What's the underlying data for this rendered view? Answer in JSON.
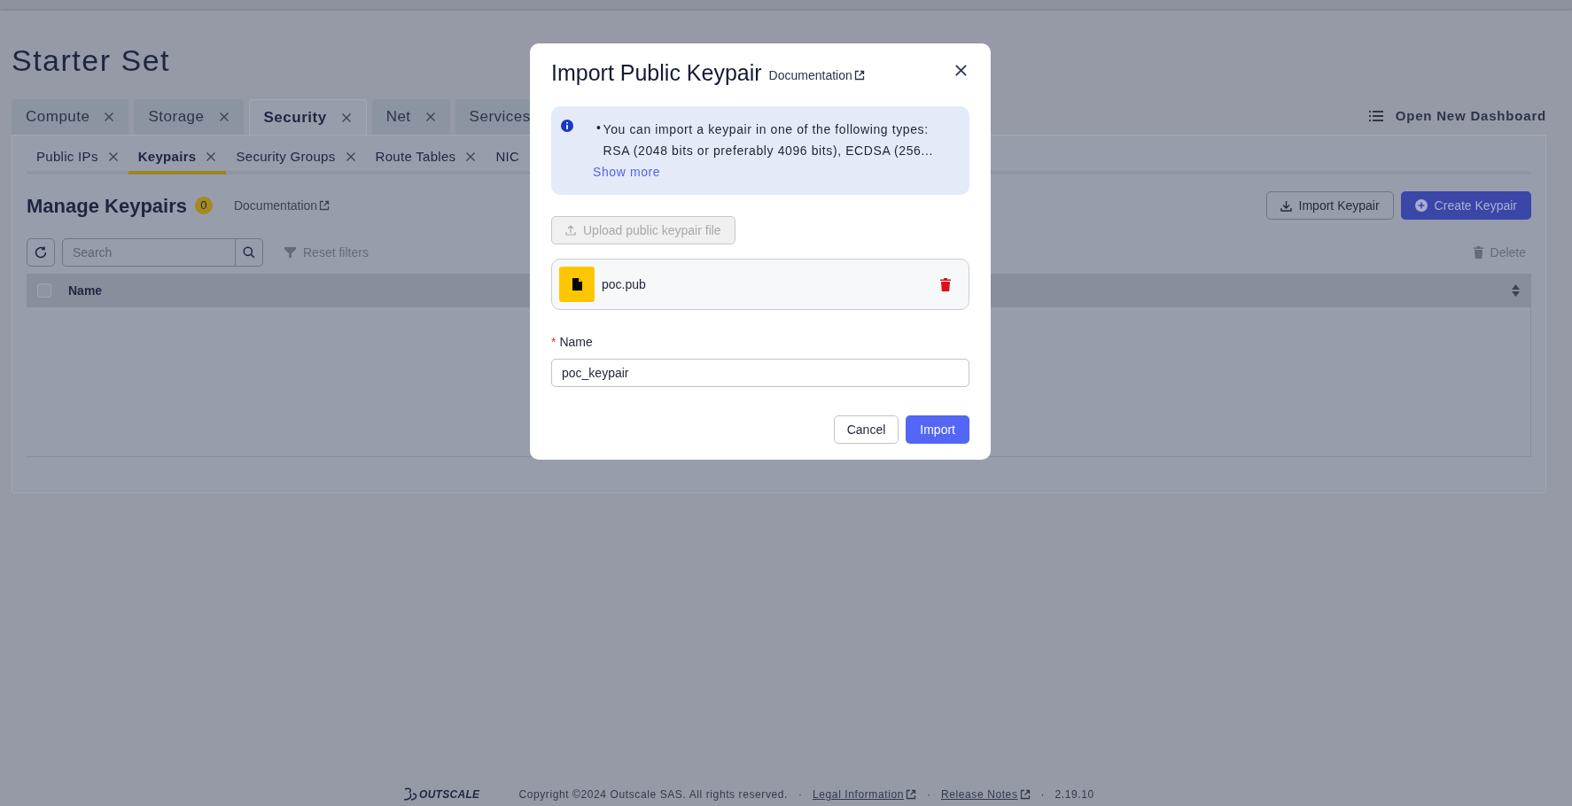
{
  "page": {
    "title": "Starter Set"
  },
  "tabs": [
    {
      "label": "Compute",
      "selected": false
    },
    {
      "label": "Storage",
      "selected": false
    },
    {
      "label": "Security",
      "selected": true
    },
    {
      "label": "Net",
      "selected": false
    },
    {
      "label": "Services",
      "selected": false
    }
  ],
  "open_dashboard": {
    "label": "Open New Dashboard"
  },
  "sub_tabs": [
    {
      "label": "Public IPs",
      "selected": false
    },
    {
      "label": "Keypairs",
      "selected": true
    },
    {
      "label": "Security Groups",
      "selected": false
    },
    {
      "label": "Route Tables",
      "selected": false
    },
    {
      "label": "NIC",
      "selected": false
    }
  ],
  "section": {
    "title": "Manage Keypairs",
    "count": "0",
    "doc_link": "Documentation",
    "import_button": "Import Keypair",
    "create_button": "Create Keypair"
  },
  "toolbar": {
    "search_placeholder": "Search",
    "reset_filters": "Reset filters",
    "delete": "Delete"
  },
  "table": {
    "select_all_checked": false,
    "columns": [
      "Name"
    ]
  },
  "modal": {
    "title": "Import Public Keypair",
    "doc_link": "Documentation",
    "info": {
      "bullet": "•",
      "lines": [
        "You can import a keypair in one of the following types: RSA (2048 bits or preferably 4096 bits), ECDSA (256..."
      ],
      "show_more": "Show more"
    },
    "upload": {
      "label": "Upload public keypair file",
      "disabled": true
    },
    "file": {
      "name": "poc.pub"
    },
    "name_field": {
      "label": "Name",
      "required": true,
      "required_mark": "*",
      "value": "poc_keypair"
    },
    "cancel": "Cancel",
    "submit": "Import"
  },
  "footer": {
    "logo": "OUTSCALE",
    "items": [
      {
        "kind": "text",
        "text": "Copyright ©2024 Outscale SAS. All rights reserved."
      },
      {
        "kind": "separator",
        "text": "·"
      },
      {
        "kind": "link",
        "text": "Legal Information"
      },
      {
        "kind": "separator",
        "text": "·"
      },
      {
        "kind": "link",
        "text": "Release Notes"
      },
      {
        "kind": "separator",
        "text": "·"
      },
      {
        "kind": "text",
        "text": "2.19.10"
      }
    ]
  }
}
